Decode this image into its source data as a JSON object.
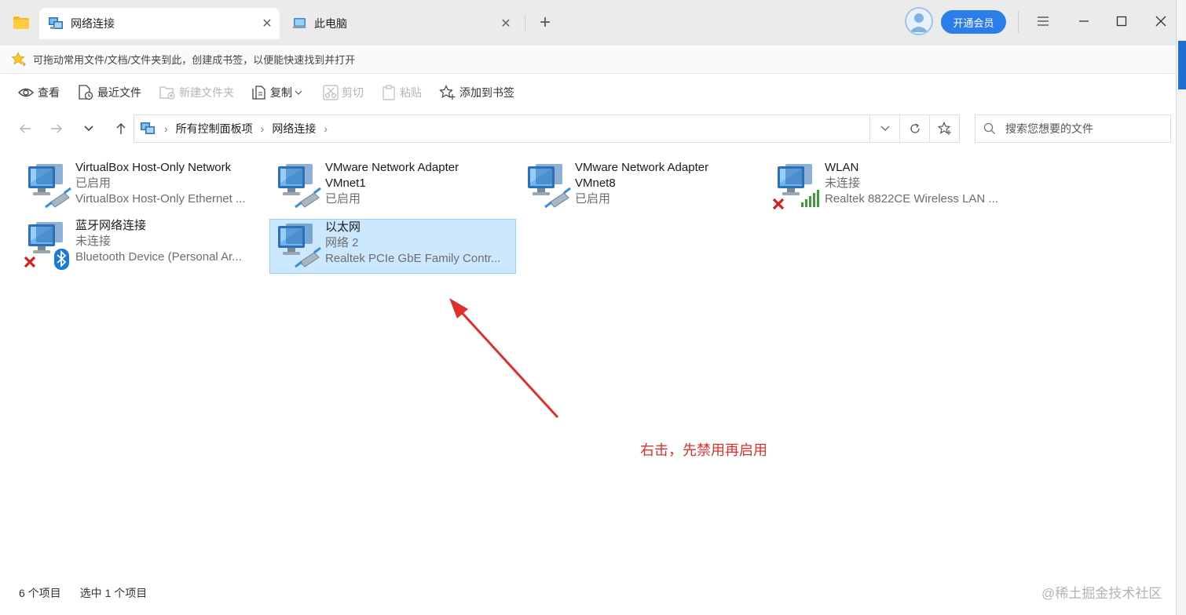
{
  "tabs": [
    {
      "label": "网络连接",
      "active": true
    },
    {
      "label": "此电脑",
      "active": false
    }
  ],
  "header": {
    "vip_label": "开通会员"
  },
  "bookmark_bar": {
    "hint": "可拖动常用文件/文档/文件夹到此，创建成书签，以便能快速找到并打开"
  },
  "toolbar": {
    "view": "查看",
    "recent": "最近文件",
    "new_folder": "新建文件夹",
    "copy": "复制",
    "cut": "剪切",
    "paste": "粘贴",
    "add_bookmark": "添加到书签"
  },
  "address": {
    "crumbs": [
      "所有控制面板项",
      "网络连接"
    ]
  },
  "search": {
    "placeholder": "搜索您想要的文件"
  },
  "connections": [
    {
      "name": "VirtualBox Host-Only Network",
      "name2": "",
      "status": "已启用",
      "device": "VirtualBox Host-Only Ethernet ...",
      "icon": "network-adapter-icon"
    },
    {
      "name": "VMware Network Adapter",
      "name2": "VMnet1",
      "status": "已启用",
      "device": "",
      "icon": "network-adapter-icon"
    },
    {
      "name": "VMware Network Adapter",
      "name2": "VMnet8",
      "status": "已启用",
      "device": "",
      "icon": "network-adapter-icon"
    },
    {
      "name": "WLAN",
      "name2": "",
      "status": "未连接",
      "device": "Realtek 8822CE Wireless LAN ...",
      "icon": "wifi-adapter-icon"
    },
    {
      "name": "蓝牙网络连接",
      "name2": "",
      "status": "未连接",
      "device": "Bluetooth Device (Personal Ar...",
      "icon": "bluetooth-adapter-icon"
    },
    {
      "name": "以太网",
      "name2": "",
      "status": "网络 2",
      "device": "Realtek PCIe GbE Family Contr...",
      "icon": "network-adapter-icon",
      "selected": true
    }
  ],
  "annotation": {
    "text": "右击，先禁用再启用",
    "color": "#e0302a"
  },
  "status_bar": {
    "count": "6 个项目",
    "selected": "选中 1 个项目"
  },
  "watermark": "@稀土掘金技术社区",
  "colors": {
    "accent": "#2b7de9",
    "selection": "#cce8ff"
  }
}
